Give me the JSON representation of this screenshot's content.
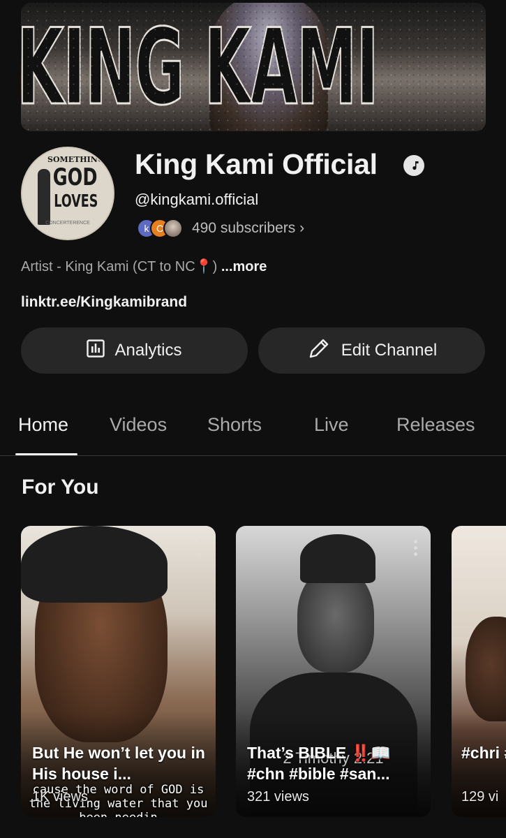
{
  "banner": {
    "text": "KING KAMI"
  },
  "avatar": {
    "line1": "SOMETHING",
    "line2": "GOD",
    "line3": "LOVES",
    "line4": "CONCERTERENCE"
  },
  "channel": {
    "name": "King Kami Official",
    "handle": "@kingkami.official",
    "verified_icon": "music-note-badge-icon",
    "subscriber_avatars": [
      {
        "letter": "k",
        "color": "#5c6bc0"
      },
      {
        "letter": "C",
        "color": "#e67e22"
      },
      {
        "letter": "",
        "color": "#9e8e84"
      }
    ],
    "subscribers": "490 subscribers",
    "chevron": "›",
    "about": "Artist - King Kami (CT to NC",
    "about_pin": "📍",
    "about_close": ")",
    "more": "...more",
    "link": "linktr.ee/Kingkamibrand"
  },
  "buttons": {
    "analytics": "Analytics",
    "edit": "Edit Channel"
  },
  "tabs": [
    "Home",
    "Videos",
    "Shorts",
    "Live",
    "Releases"
  ],
  "active_tab": "Home",
  "section": {
    "title": "For You"
  },
  "shorts": [
    {
      "title": "But He won’t let you in His house i...",
      "views": "1K views",
      "caption": "cause the word of GOD is the living water that you been needin"
    },
    {
      "title": "That’s BIBLE ‼️📖 #chn #bible #san...",
      "views": "321 views",
      "caption": "2 Timothy 2:21"
    },
    {
      "title": "#chri #new",
      "views": "129 vi"
    }
  ]
}
